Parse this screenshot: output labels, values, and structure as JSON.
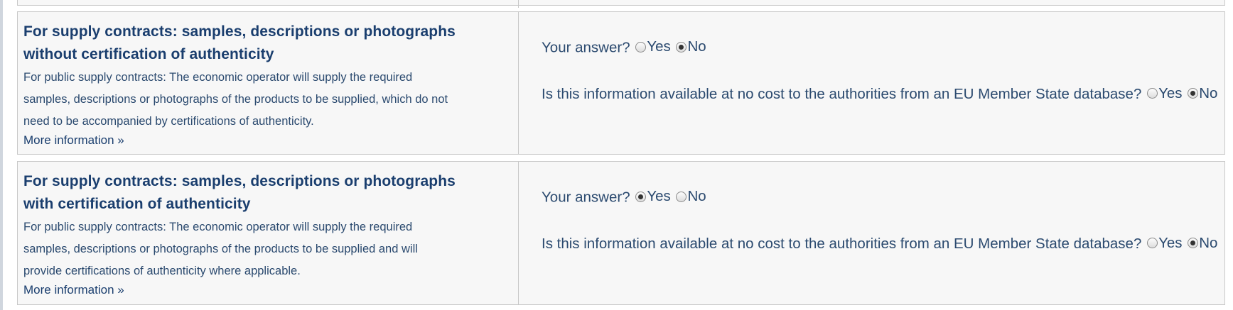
{
  "criteria": [
    {
      "title": "For supply contracts: samples, descriptions or photographs without certification of authenticity",
      "title_line1": "For supply contracts: samples, descriptions or photographs",
      "title_line2": "without certification of authenticity",
      "desc_line1": "For public supply contracts: The economic operator will supply the required",
      "desc_line2": "samples, descriptions or photographs of the products to be supplied, which do not",
      "desc_line3": "need to be accompanied by certifications of authenticity.",
      "more_info": "More information »",
      "answer_question": "Your answer?",
      "answer_yes": "Yes",
      "answer_no": "No",
      "answer_selected": "No",
      "db_question": "Is this information available at no cost to the authorities from an EU Member State database?",
      "db_yes": "Yes",
      "db_no": "No",
      "db_selected": "No"
    },
    {
      "title": "For supply contracts: samples, descriptions or photographs with certification of authenticity",
      "title_line1": "For supply contracts: samples, descriptions or photographs",
      "title_line2": "with certification of authenticity",
      "desc_line1": "For public supply contracts: The economic operator will supply the required",
      "desc_line2": "samples, descriptions or photographs of the products to be supplied and will",
      "desc_line3": "provide certifications of authenticity where applicable.",
      "more_info": "More information »",
      "answer_question": "Your answer?",
      "answer_yes": "Yes",
      "answer_no": "No",
      "answer_selected": "Yes",
      "db_question": "Is this information available at no cost to the authorities from an EU Member State database?",
      "db_yes": "Yes",
      "db_no": "No",
      "db_selected": "No"
    }
  ],
  "colors": {
    "title": "#1a3e6e",
    "text": "#2b4a6f",
    "border": "#c8c8c8",
    "panel_bg": "#f7f7f7"
  }
}
